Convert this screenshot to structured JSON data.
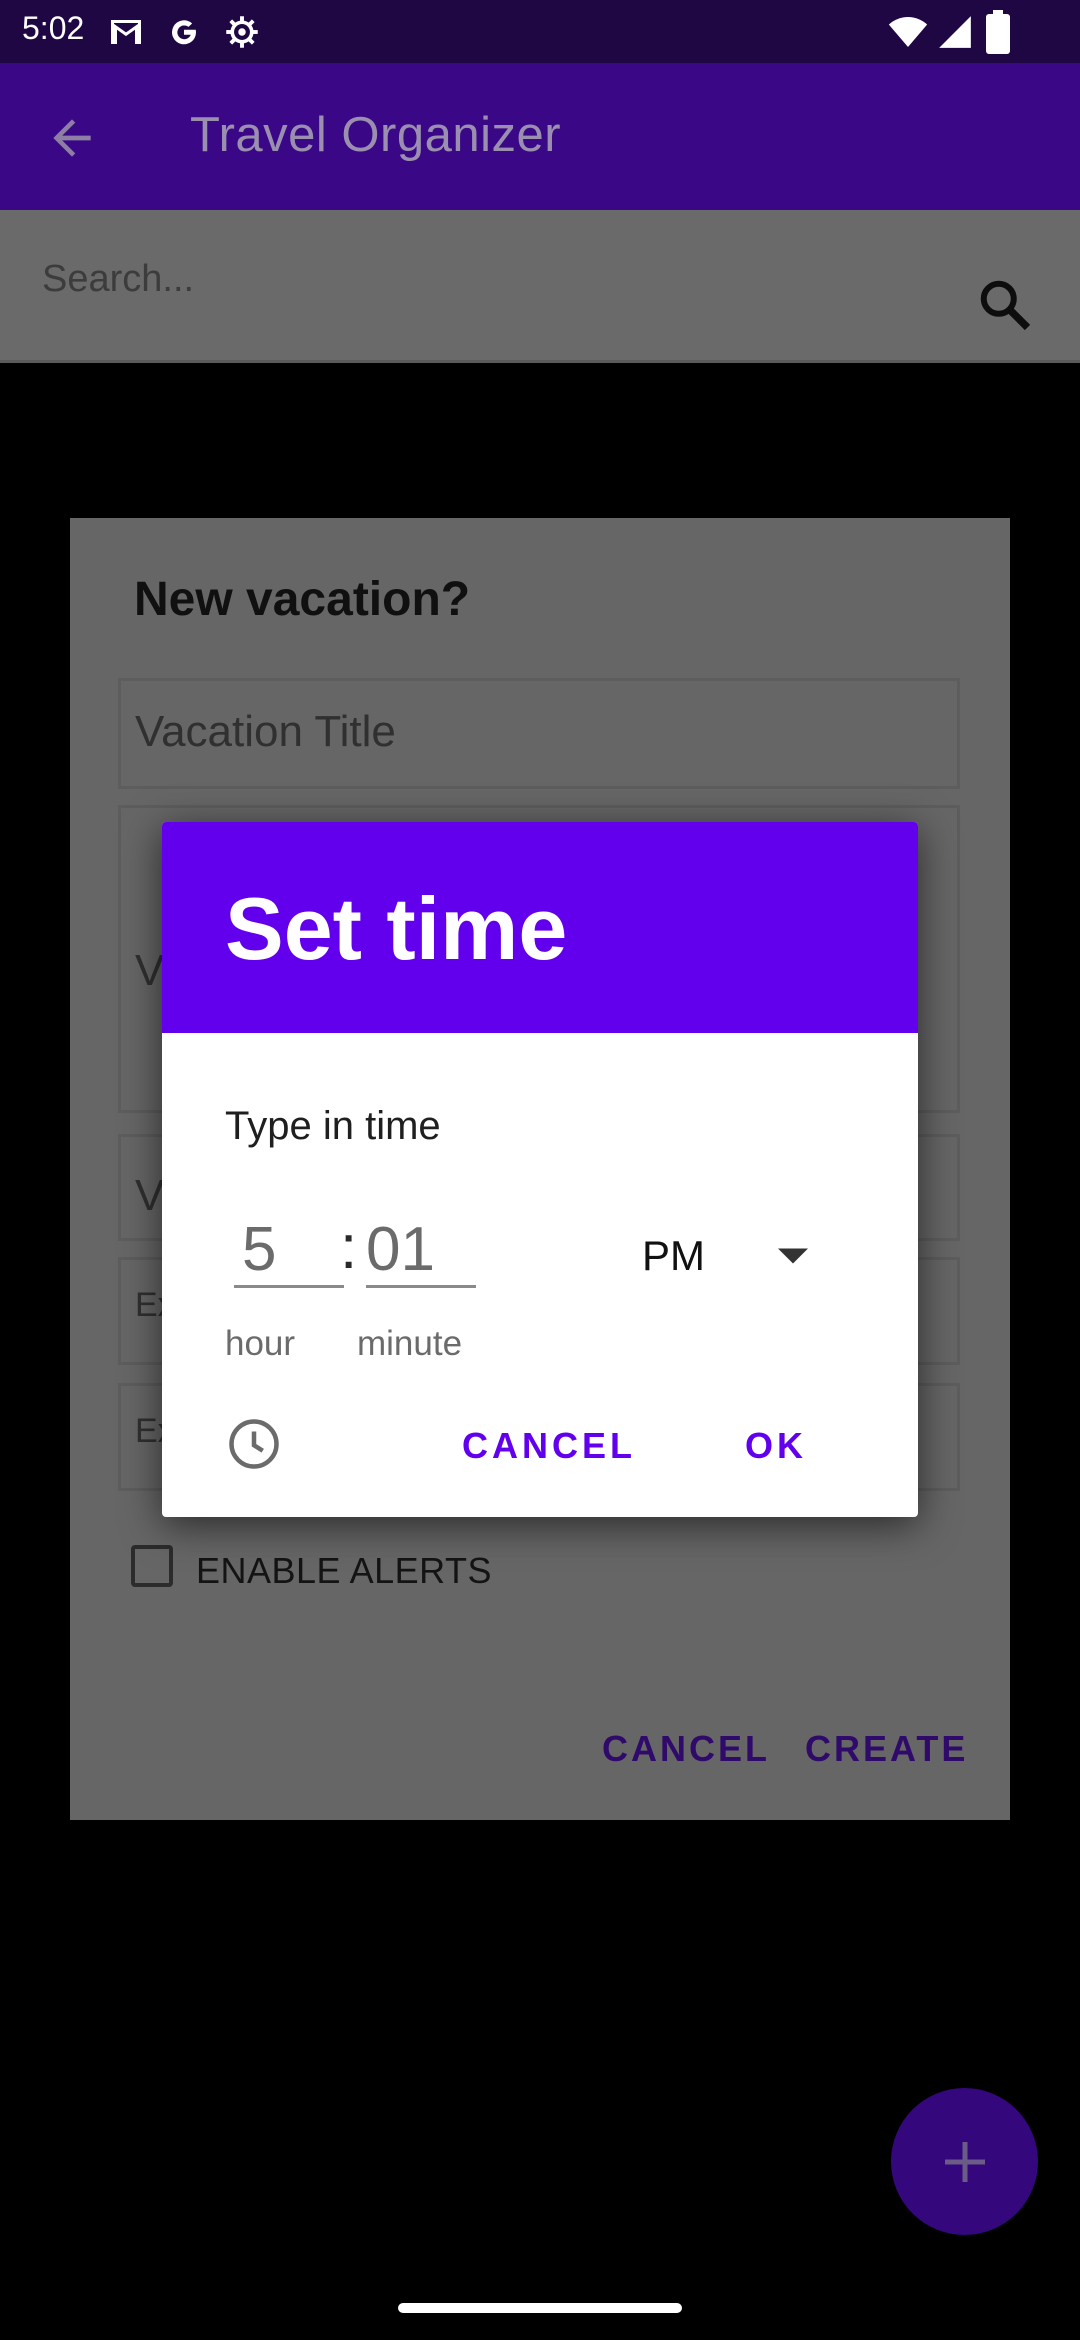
{
  "status_bar": {
    "time": "5:02",
    "icons": [
      "gmail-icon",
      "google-icon",
      "settings-icon",
      "wifi-icon",
      "signal-icon",
      "battery-icon"
    ]
  },
  "app_bar": {
    "title": "Travel Organizer",
    "back_icon": "arrow-back-icon"
  },
  "search": {
    "placeholder": "Search...",
    "icon": "search-icon"
  },
  "background_dialog": {
    "title": "New vacation?",
    "fields": [
      {
        "label": "Vacation Title",
        "visible_text": "Vacation Title"
      },
      {
        "label": "V",
        "visible_text": "V"
      },
      {
        "label": "V",
        "visible_text": "V"
      },
      {
        "label": "Ex",
        "visible_text": "Ex"
      },
      {
        "label": "Ex",
        "visible_text": "Ex"
      }
    ],
    "checkbox_label": "ENABLE ALERTS",
    "cancel_label": "CANCEL",
    "create_label": "CREATE"
  },
  "time_picker": {
    "header_title": "Set time",
    "type_label": "Type in time",
    "hour_value": "5",
    "separator": ":",
    "minute_value": "01",
    "hour_label": "hour",
    "minute_label": "minute",
    "ampm_value": "PM",
    "cancel_label": "CANCEL",
    "ok_label": "OK",
    "accent_color": "#6200ee"
  },
  "fab": {
    "icon": "plus-icon"
  }
}
